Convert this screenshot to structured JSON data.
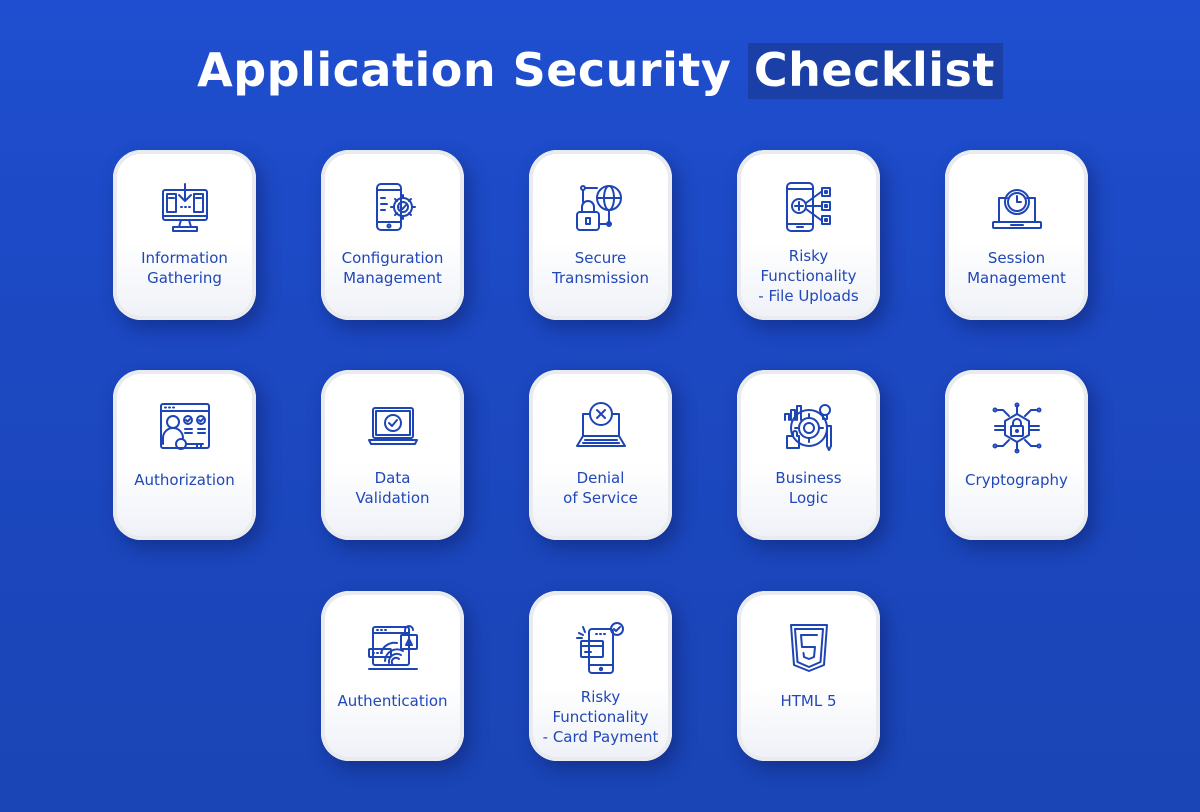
{
  "title": {
    "main": "Application Security",
    "highlight": "Checklist"
  },
  "colors": {
    "background": "#1c48c2",
    "highlight_box": "#1a3fa6",
    "card": "#ffffff",
    "accent": "#2147b8"
  },
  "cards": [
    {
      "line1": "Information",
      "line2": "Gathering",
      "line3": "",
      "icon": "monitor-download-icon"
    },
    {
      "line1": "Configuration",
      "line2": "Management",
      "line3": "",
      "icon": "phone-gear-icon"
    },
    {
      "line1": "Secure",
      "line2": "Transmission",
      "line3": "",
      "icon": "lock-globe-icon"
    },
    {
      "line1": "Risky",
      "line2": "Functionality",
      "line3": "- File Uploads",
      "icon": "phone-upload-icon"
    },
    {
      "line1": "Session",
      "line2": "Management",
      "line3": "",
      "icon": "laptop-clock-icon"
    },
    {
      "line1": "Authorization",
      "line2": "",
      "line3": "",
      "icon": "user-key-icon"
    },
    {
      "line1": "Data",
      "line2": "Validation",
      "line3": "",
      "icon": "laptop-check-icon"
    },
    {
      "line1": "Denial",
      "line2": "of Service",
      "line3": "",
      "icon": "laptop-x-icon"
    },
    {
      "line1": "Business",
      "line2": "Logic",
      "line3": "",
      "icon": "gear-bulb-icon"
    },
    {
      "line1": "Cryptography",
      "line2": "",
      "line3": "",
      "icon": "circuit-lock-icon"
    },
    {
      "line1": "Authentication",
      "line2": "",
      "line3": "",
      "icon": "fingerprint-icon"
    },
    {
      "line1": "Risky",
      "line2": "Functionality",
      "line3": "- Card Payment",
      "icon": "phone-card-icon"
    },
    {
      "line1": "HTML 5",
      "line2": "",
      "line3": "",
      "icon": "html5-icon"
    }
  ]
}
